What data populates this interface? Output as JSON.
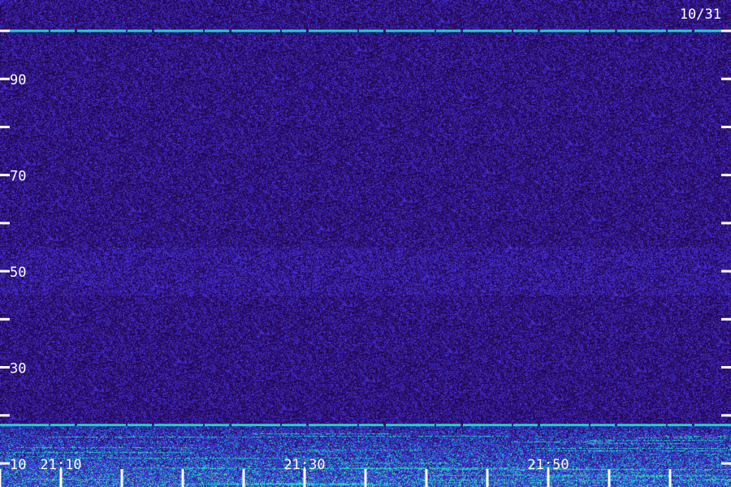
{
  "date_label": "10/31",
  "colors": {
    "background": "#220a55",
    "noise": "#3a1fb0",
    "signal": "#20d0c8",
    "strong": "#9af05a",
    "tick": "#ffffff"
  },
  "chart_data": {
    "type": "heatmap",
    "title": "",
    "xlabel": "",
    "ylabel": "",
    "x_range": [
      "21:05",
      "22:05"
    ],
    "y_range": [
      10,
      100
    ],
    "y_ticks": [
      10,
      20,
      30,
      40,
      50,
      60,
      70,
      80,
      90,
      100
    ],
    "y_tick_labels": [
      {
        "value": 10,
        "label": "10"
      },
      {
        "value": 30,
        "label": "30"
      },
      {
        "value": 50,
        "label": "50"
      },
      {
        "value": 70,
        "label": "70"
      },
      {
        "value": 90,
        "label": "90"
      }
    ],
    "x_ticks": [
      "21:05",
      "21:10",
      "21:15",
      "21:20",
      "21:25",
      "21:30",
      "21:35",
      "21:40",
      "21:45",
      "21:50",
      "21:55",
      "22:00"
    ],
    "x_tick_labels": [
      {
        "value": "21:10",
        "label": "21:10"
      },
      {
        "value": "21:30",
        "label": "21:30"
      },
      {
        "value": "21:50",
        "label": "21:50"
      }
    ],
    "constant_lines": [
      {
        "y": 100,
        "color": "cyan"
      },
      {
        "y": 18,
        "color": "cyan"
      }
    ],
    "intensity_regions": [
      {
        "y_min": 10,
        "y_max": 18,
        "intensity": "high"
      },
      {
        "y_min": 45,
        "y_max": 55,
        "intensity": "medium"
      },
      {
        "y_min": 18,
        "y_max": 100,
        "intensity": "low"
      }
    ]
  }
}
